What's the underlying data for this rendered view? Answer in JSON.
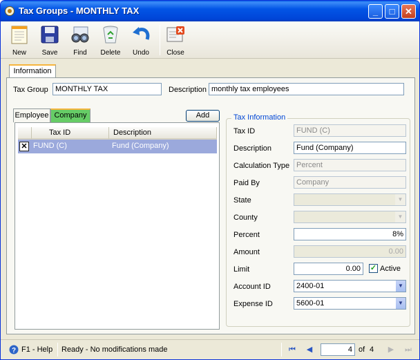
{
  "window": {
    "title": "Tax Groups - MONTHLY TAX"
  },
  "toolbar": {
    "new": "New",
    "save": "Save",
    "find": "Find",
    "delete": "Delete",
    "undo": "Undo",
    "close": "Close"
  },
  "tabs": {
    "information": "Information"
  },
  "header": {
    "tax_group_label": "Tax Group",
    "tax_group_value": "MONTHLY TAX",
    "description_label": "Description",
    "description_value": "monthly tax employees"
  },
  "subtabs": {
    "employee": "Employee",
    "company": "Company"
  },
  "add_button": "Add",
  "grid": {
    "columns": [
      "Tax ID",
      "Description"
    ],
    "rows": [
      {
        "checked": "✕",
        "tax_id": "FUND (C)",
        "description": "Fund (Company)"
      }
    ]
  },
  "tax_info": {
    "title": "Tax Information",
    "tax_id_label": "Tax ID",
    "tax_id_value": "FUND (C)",
    "description_label": "Description",
    "description_value": "Fund (Company)",
    "calc_type_label": "Calculation Type",
    "calc_type_value": "Percent",
    "paid_by_label": "Paid By",
    "paid_by_value": "Company",
    "state_label": "State",
    "state_value": "",
    "county_label": "County",
    "county_value": "",
    "percent_label": "Percent",
    "percent_value": "8%",
    "amount_label": "Amount",
    "amount_value": "0.00",
    "limit_label": "Limit",
    "limit_value": "0.00",
    "active_label": "Active",
    "active_check": "✓",
    "account_id_label": "Account ID",
    "account_id_value": "2400-01",
    "expense_id_label": "Expense ID",
    "expense_id_value": "5600-01"
  },
  "status": {
    "help": "F1 - Help",
    "message": "Ready - No modifications made",
    "page": "4",
    "of_label": "of",
    "total": "4"
  },
  "icons": {
    "help": "help-icon",
    "first": "first-record-icon",
    "prev": "previous-record-icon",
    "next": "next-record-icon",
    "last": "last-record-icon"
  }
}
